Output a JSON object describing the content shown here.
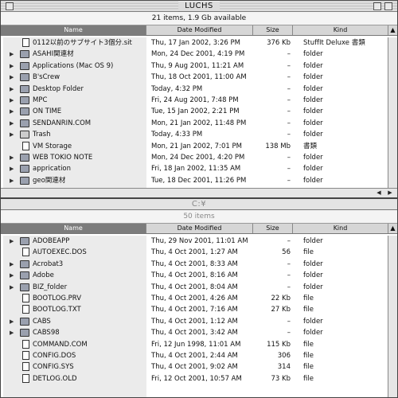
{
  "windows": [
    {
      "title": "LUCHS",
      "info": "21 items, 1.9 Gb available",
      "columns": {
        "name": "Name",
        "date": "Date Modified",
        "size": "Size",
        "kind": "Kind"
      },
      "rows": [
        {
          "name": "0112以前のサブサイト3個分.sit",
          "date": "Thu, 17 Jan 2002, 3:26 PM",
          "size": "376 Kb",
          "kind": "StuffIt Deluxe 書類",
          "icon": "document-icon",
          "expandable": false
        },
        {
          "name": "ASAHI関連材",
          "date": "Mon, 24 Dec 2001, 4:19 PM",
          "size": "–",
          "kind": "folder",
          "icon": "folder-icon",
          "expandable": true
        },
        {
          "name": "Applications (Mac OS 9)",
          "date": "Thu, 9 Aug 2001, 11:21 AM",
          "size": "–",
          "kind": "folder",
          "icon": "folder-icon",
          "expandable": true
        },
        {
          "name": "B'sCrew",
          "date": "Thu, 18 Oct 2001, 11:00 AM",
          "size": "–",
          "kind": "folder",
          "icon": "folder-icon",
          "expandable": true
        },
        {
          "name": "Desktop Folder",
          "date": "Today, 4:32 PM",
          "size": "–",
          "kind": "folder",
          "icon": "folder-icon",
          "expandable": true
        },
        {
          "name": "MPC",
          "date": "Fri, 24 Aug 2001, 7:48 PM",
          "size": "–",
          "kind": "folder",
          "icon": "folder-icon",
          "expandable": true
        },
        {
          "name": "ON TIME",
          "date": "Tue, 15 Jan 2002, 2:21 PM",
          "size": "–",
          "kind": "folder",
          "icon": "folder-icon",
          "expandable": true
        },
        {
          "name": "SENDANRIN.COM",
          "date": "Mon, 21 Jan 2002, 11:48 PM",
          "size": "–",
          "kind": "folder",
          "icon": "folder-icon",
          "expandable": true
        },
        {
          "name": "Trash",
          "date": "Today, 4:33 PM",
          "size": "–",
          "kind": "folder",
          "icon": "trash-icon",
          "expandable": true
        },
        {
          "name": "VM Storage",
          "date": "Mon, 21 Jan 2002, 7:01 PM",
          "size": "138 Mb",
          "kind": "書類",
          "icon": "document-icon",
          "expandable": false
        },
        {
          "name": "WEB TOKIO NOTE",
          "date": "Mon, 24 Dec 2001, 4:20 PM",
          "size": "–",
          "kind": "folder",
          "icon": "folder-icon",
          "expandable": true
        },
        {
          "name": "apprication",
          "date": "Fri, 18 Jan 2002, 11:35 AM",
          "size": "–",
          "kind": "folder",
          "icon": "folder-icon",
          "expandable": true
        },
        {
          "name": "geo関連材",
          "date": "Tue, 18 Dec 2001, 11:26 PM",
          "size": "–",
          "kind": "folder",
          "icon": "folder-icon",
          "expandable": true
        }
      ]
    },
    {
      "title": "C:¥",
      "info": "50 items",
      "columns": {
        "name": "Name",
        "date": "Date Modified",
        "size": "Size",
        "kind": "Kind"
      },
      "rows": [
        {
          "name": "ADOBEAPP",
          "date": "Thu, 29 Nov 2001, 11:01 AM",
          "size": "–",
          "kind": "folder",
          "icon": "folder-icon",
          "expandable": true
        },
        {
          "name": "AUTOEXEC.DOS",
          "date": "Thu, 4 Oct 2001, 1:27 AM",
          "size": "56",
          "kind": "file",
          "icon": "document-icon",
          "expandable": false
        },
        {
          "name": "Acrobat3",
          "date": "Thu, 4 Oct 2001, 8:33 AM",
          "size": "–",
          "kind": "folder",
          "icon": "folder-icon",
          "expandable": true
        },
        {
          "name": "Adobe",
          "date": "Thu, 4 Oct 2001, 8:16 AM",
          "size": "–",
          "kind": "folder",
          "icon": "folder-icon",
          "expandable": true
        },
        {
          "name": "BIZ_folder",
          "date": "Thu, 4 Oct 2001, 8:04 AM",
          "size": "–",
          "kind": "folder",
          "icon": "folder-icon",
          "expandable": true
        },
        {
          "name": "BOOTLOG.PRV",
          "date": "Thu, 4 Oct 2001, 4:26 AM",
          "size": "22 Kb",
          "kind": "file",
          "icon": "document-icon",
          "expandable": false
        },
        {
          "name": "BOOTLOG.TXT",
          "date": "Thu, 4 Oct 2001, 7:16 AM",
          "size": "27 Kb",
          "kind": "file",
          "icon": "document-icon",
          "expandable": false
        },
        {
          "name": "CABS",
          "date": "Thu, 4 Oct 2001, 1:12 AM",
          "size": "–",
          "kind": "folder",
          "icon": "folder-icon",
          "expandable": true
        },
        {
          "name": "CABS98",
          "date": "Thu, 4 Oct 2001, 3:42 AM",
          "size": "–",
          "kind": "folder",
          "icon": "folder-icon",
          "expandable": true
        },
        {
          "name": "COMMAND.COM",
          "date": "Fri, 12 Jun 1998, 11:01 AM",
          "size": "115 Kb",
          "kind": "file",
          "icon": "document-icon",
          "expandable": false
        },
        {
          "name": "CONFIG.DOS",
          "date": "Thu, 4 Oct 2001, 2:44 AM",
          "size": "306",
          "kind": "file",
          "icon": "document-icon",
          "expandable": false
        },
        {
          "name": "CONFIG.SYS",
          "date": "Thu, 4 Oct 2001, 9:02 AM",
          "size": "314",
          "kind": "file",
          "icon": "document-icon",
          "expandable": false
        },
        {
          "name": "DETLOG.OLD",
          "date": "Fri, 12 Oct 2001, 10:57 AM",
          "size": "73 Kb",
          "kind": "file",
          "icon": "document-icon",
          "expandable": false
        }
      ]
    }
  ]
}
